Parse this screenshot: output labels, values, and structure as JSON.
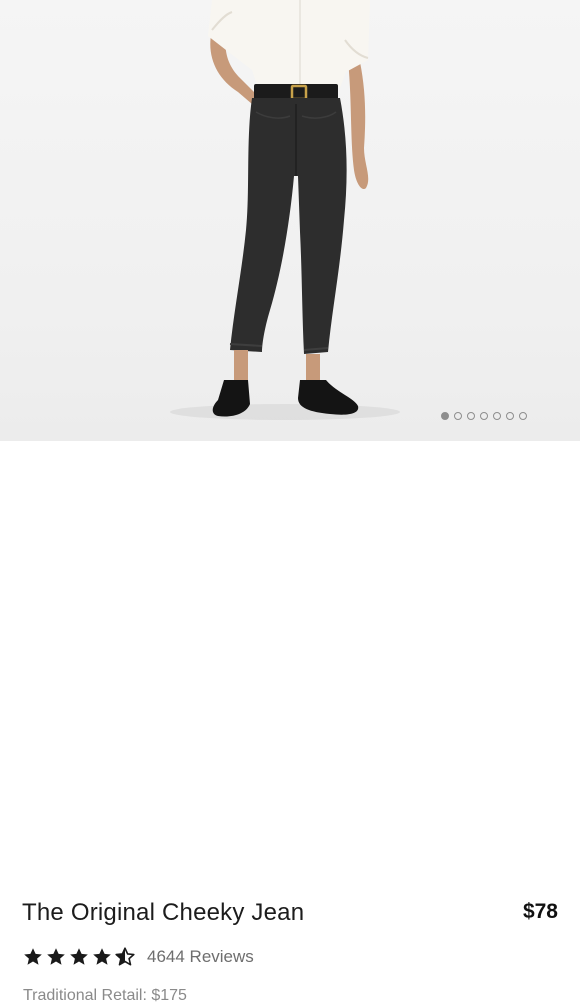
{
  "product": {
    "name": "The Original Cheeky Jean",
    "price": "$78",
    "rating": 4.5,
    "reviews_label": "4644 Reviews",
    "retail_label": "Traditional Retail: $175"
  },
  "carousel": {
    "count": 7,
    "active_index": 0
  },
  "colors": {
    "jean": "#2d2d2d",
    "shirt": "#f8f6f1",
    "star": "#1a1a1a",
    "dot": "#8e8e8e"
  },
  "icons": {
    "star_full": "star-icon",
    "star_half": "star-half-icon"
  }
}
